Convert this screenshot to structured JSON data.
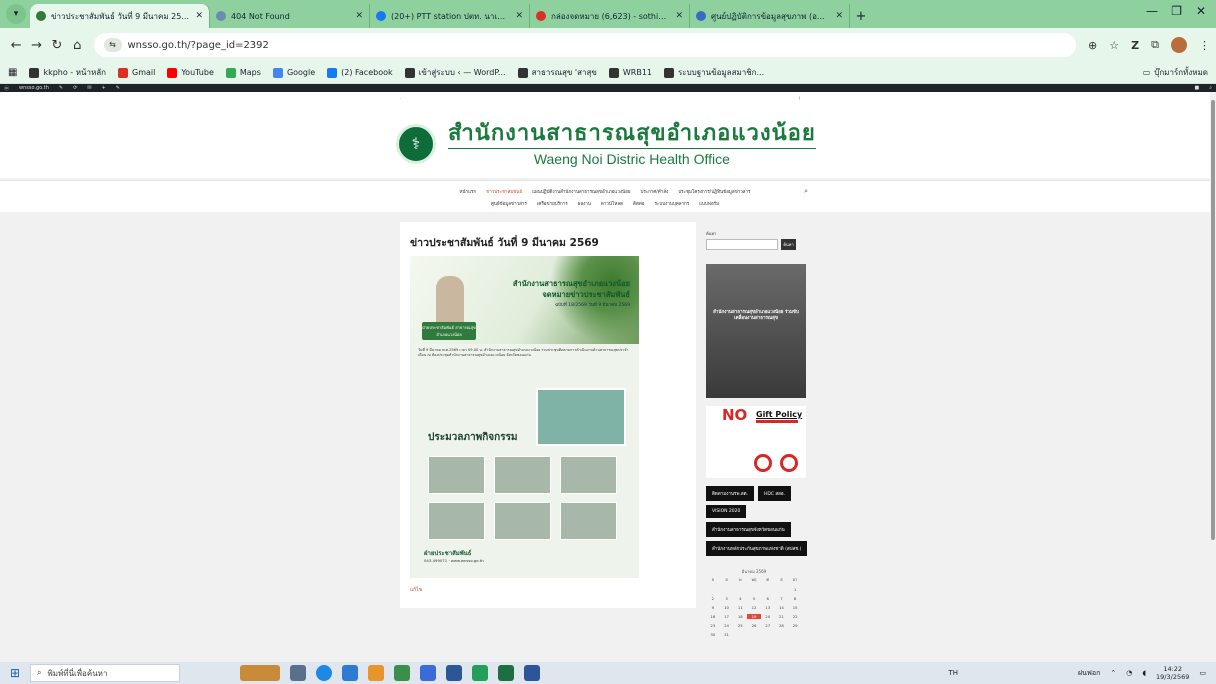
{
  "browser": {
    "tabs": [
      {
        "title": "ข่าวประชาสัมพันธ์ วันที่ 9 มีนาคม 25...",
        "active": true,
        "color": "#2f7a3c"
      },
      {
        "title": "404 Not Found",
        "active": false,
        "color": "#6d8ab5"
      },
      {
        "title": "(20+) PTT station ปตท. นาเหนือ | ...",
        "active": false,
        "color": "#1877f2"
      },
      {
        "title": "กล่องจดหมาย (6,623) - sothidad...",
        "active": false,
        "color": "#d93025"
      },
      {
        "title": "ศูนย์ปฏิบัติการข้อมูลสุขภาพ (อ...",
        "active": false,
        "color": "#3a6bc4"
      }
    ],
    "url": "wnsso.go.th/?page_id=2392",
    "bookmarks": [
      {
        "label": "kkpho - หน้าหลัก",
        "color": "#333"
      },
      {
        "label": "Gmail",
        "color": "#d93025"
      },
      {
        "label": "YouTube",
        "color": "#ff0000"
      },
      {
        "label": "Maps",
        "color": "#34a853"
      },
      {
        "label": "Google",
        "color": "#4285f4"
      },
      {
        "label": "(2) Facebook",
        "color": "#1877f2"
      },
      {
        "label": "เข้าสู่ระบบ ‹ — WordP...",
        "color": "#333"
      },
      {
        "label": "สาธารณสุข 'สาสุข",
        "color": "#333"
      },
      {
        "label": "WRB11",
        "color": "#333"
      },
      {
        "label": "ระบบฐานข้อมูลสมาชิก...",
        "color": "#333"
      }
    ],
    "bookmarks_right": "บุ๊กมาร์กทั้งหมด"
  },
  "site": {
    "name_th": "สำนักงานสาธารณสุขอำเภอแวงน้อย",
    "name_en": "Waeng Noi Distric Health Office",
    "menu_row1": [
      "หน้าแรก",
      "ข่าวประชาสัมพันธ์",
      "แผนปฏิบัติงานสำนักงานสาธารณสุขอำเภอแวงน้อย",
      "ประกาศ/คำสั่ง",
      "ประชุมโครงการ/ปฏิทินข้อมูลข่าวสาร"
    ],
    "menu_row2": [
      "ศูนย์ข้อมูลข่าวสาร",
      "เครือข่ายบริการ",
      "ผลงาน",
      "ดาวน์โหลด",
      "ติดต่อ",
      "ระบบงานบุคลากร",
      "แบบฟอร์ม"
    ]
  },
  "post": {
    "title": "ข่าวประชาสัมพันธ์ วันที่ 9 มีนาคม 2569",
    "poster_title1": "สำนักงานสาธารณสุขอำเภอแวงน้อย",
    "poster_title2": "จดหมายข่าวประชาสัมพันธ์",
    "poster_issue": "ฉบับที่ 18/2569 วันที่ 9 มีนาคม 2569",
    "poster_badge": "ฝ่ายประชาสัมพันธ์ สาธารณสุขอำเภอแวงน้อย",
    "poster_body": "วันที่ 9 มีนาคม พ.ศ.2569 เวลา 09.00 น. สำนักงานสาธารณสุขอำเภอแวงน้อย ร่วมประชุมติดตามการดำเนินงานด้านสาธารณสุขประจำเดือน ณ ห้องประชุมสำนักงานสาธารณสุขอำเภอแวงน้อย จังหวัดขอนแก่น",
    "activity_title": "ประมวลภาพกิจกรรม",
    "footer_title": "ฝ่ายประชาสัมพันธ์",
    "footer_contact": "043-499071 · www.wnsso.go.th",
    "read_more": "แก้ไข"
  },
  "sidebar": {
    "search_label": "ค้นหา",
    "search_button": "ค้นหา",
    "banner_text": "สำนักงานสาธารณสุขอำเภอแวงน้อย ร่วมขับเคลื่อนงานสาธารณสุข",
    "gift_no": "NO",
    "gift_policy": "Gift Policy",
    "links": [
      "ติดตามงานรพ.สต.",
      "HDC สสอ.",
      "VISION 2020",
      "สำนักงานสาธารณสุขจังหวัดขอนแก่น",
      "สำนักงานหลักประกันสุขภาพแห่งชาติ (สปสช.)"
    ],
    "calendar": {
      "title": "มีนาคม 2569",
      "headers": [
        "จ",
        "อ",
        "พ",
        "พฤ",
        "ศ",
        "ส",
        "อา"
      ],
      "cells": [
        "",
        "",
        "",
        "",
        "",
        "",
        "1",
        "2",
        "3",
        "4",
        "5",
        "6",
        "7",
        "8",
        "9",
        "10",
        "11",
        "12",
        "13",
        "14",
        "15",
        "16",
        "17",
        "18",
        "19",
        "20",
        "21",
        "22",
        "23",
        "24",
        "25",
        "26",
        "27",
        "28",
        "29",
        "30",
        "31",
        "",
        "",
        "",
        "",
        ""
      ],
      "today": "19"
    }
  },
  "taskbar": {
    "search_placeholder": "พิมพ์ที่นี่เพื่อค้นหา",
    "lang": "TH",
    "weather": "ฝนฟอก",
    "time": "14:22",
    "date": "19/3/2569"
  }
}
